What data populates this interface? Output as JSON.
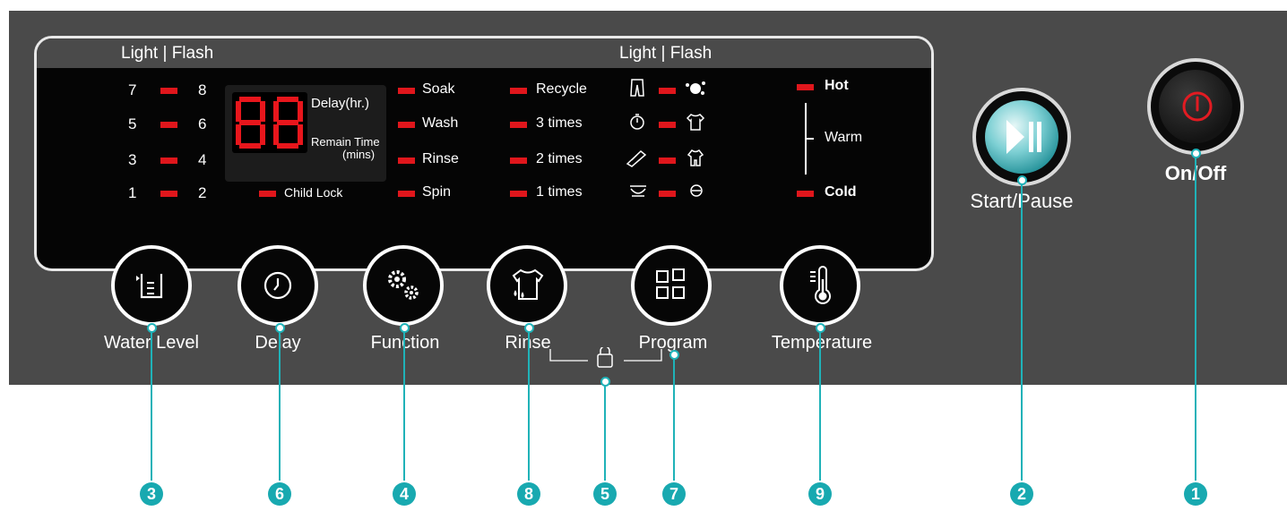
{
  "panel": {
    "header_left": "Light | Flash",
    "header_right": "Light | Flash",
    "water_levels": [
      "7",
      "8",
      "5",
      "6",
      "3",
      "4",
      "1",
      "2"
    ],
    "display": {
      "digits": "88",
      "delay_label": "Delay(hr.)",
      "remain_label_1": "Remain Time",
      "remain_label_2": "(mins)",
      "child_lock": "Child Lock"
    },
    "functions": [
      "Soak",
      "Wash",
      "Rinse",
      "Spin"
    ],
    "rinse_counts": [
      "Recycle",
      "3 times",
      "2 times",
      "1 times"
    ],
    "temperature": {
      "hot": "Hot",
      "warm": "Warm",
      "cold": "Cold"
    }
  },
  "buttons": {
    "water_level": "Water Level",
    "delay": "Delay",
    "function": "Function",
    "rinse": "Rinse",
    "program": "Program",
    "temperature": "Temperature",
    "start_pause": "Start/Pause",
    "on_off": "On/Off"
  },
  "callouts": [
    "3",
    "6",
    "4",
    "8",
    "5",
    "7",
    "9",
    "2",
    "1"
  ],
  "colors": {
    "led": "#e0161c",
    "callout": "#18a9b0",
    "panel": "#4a4a4a"
  }
}
